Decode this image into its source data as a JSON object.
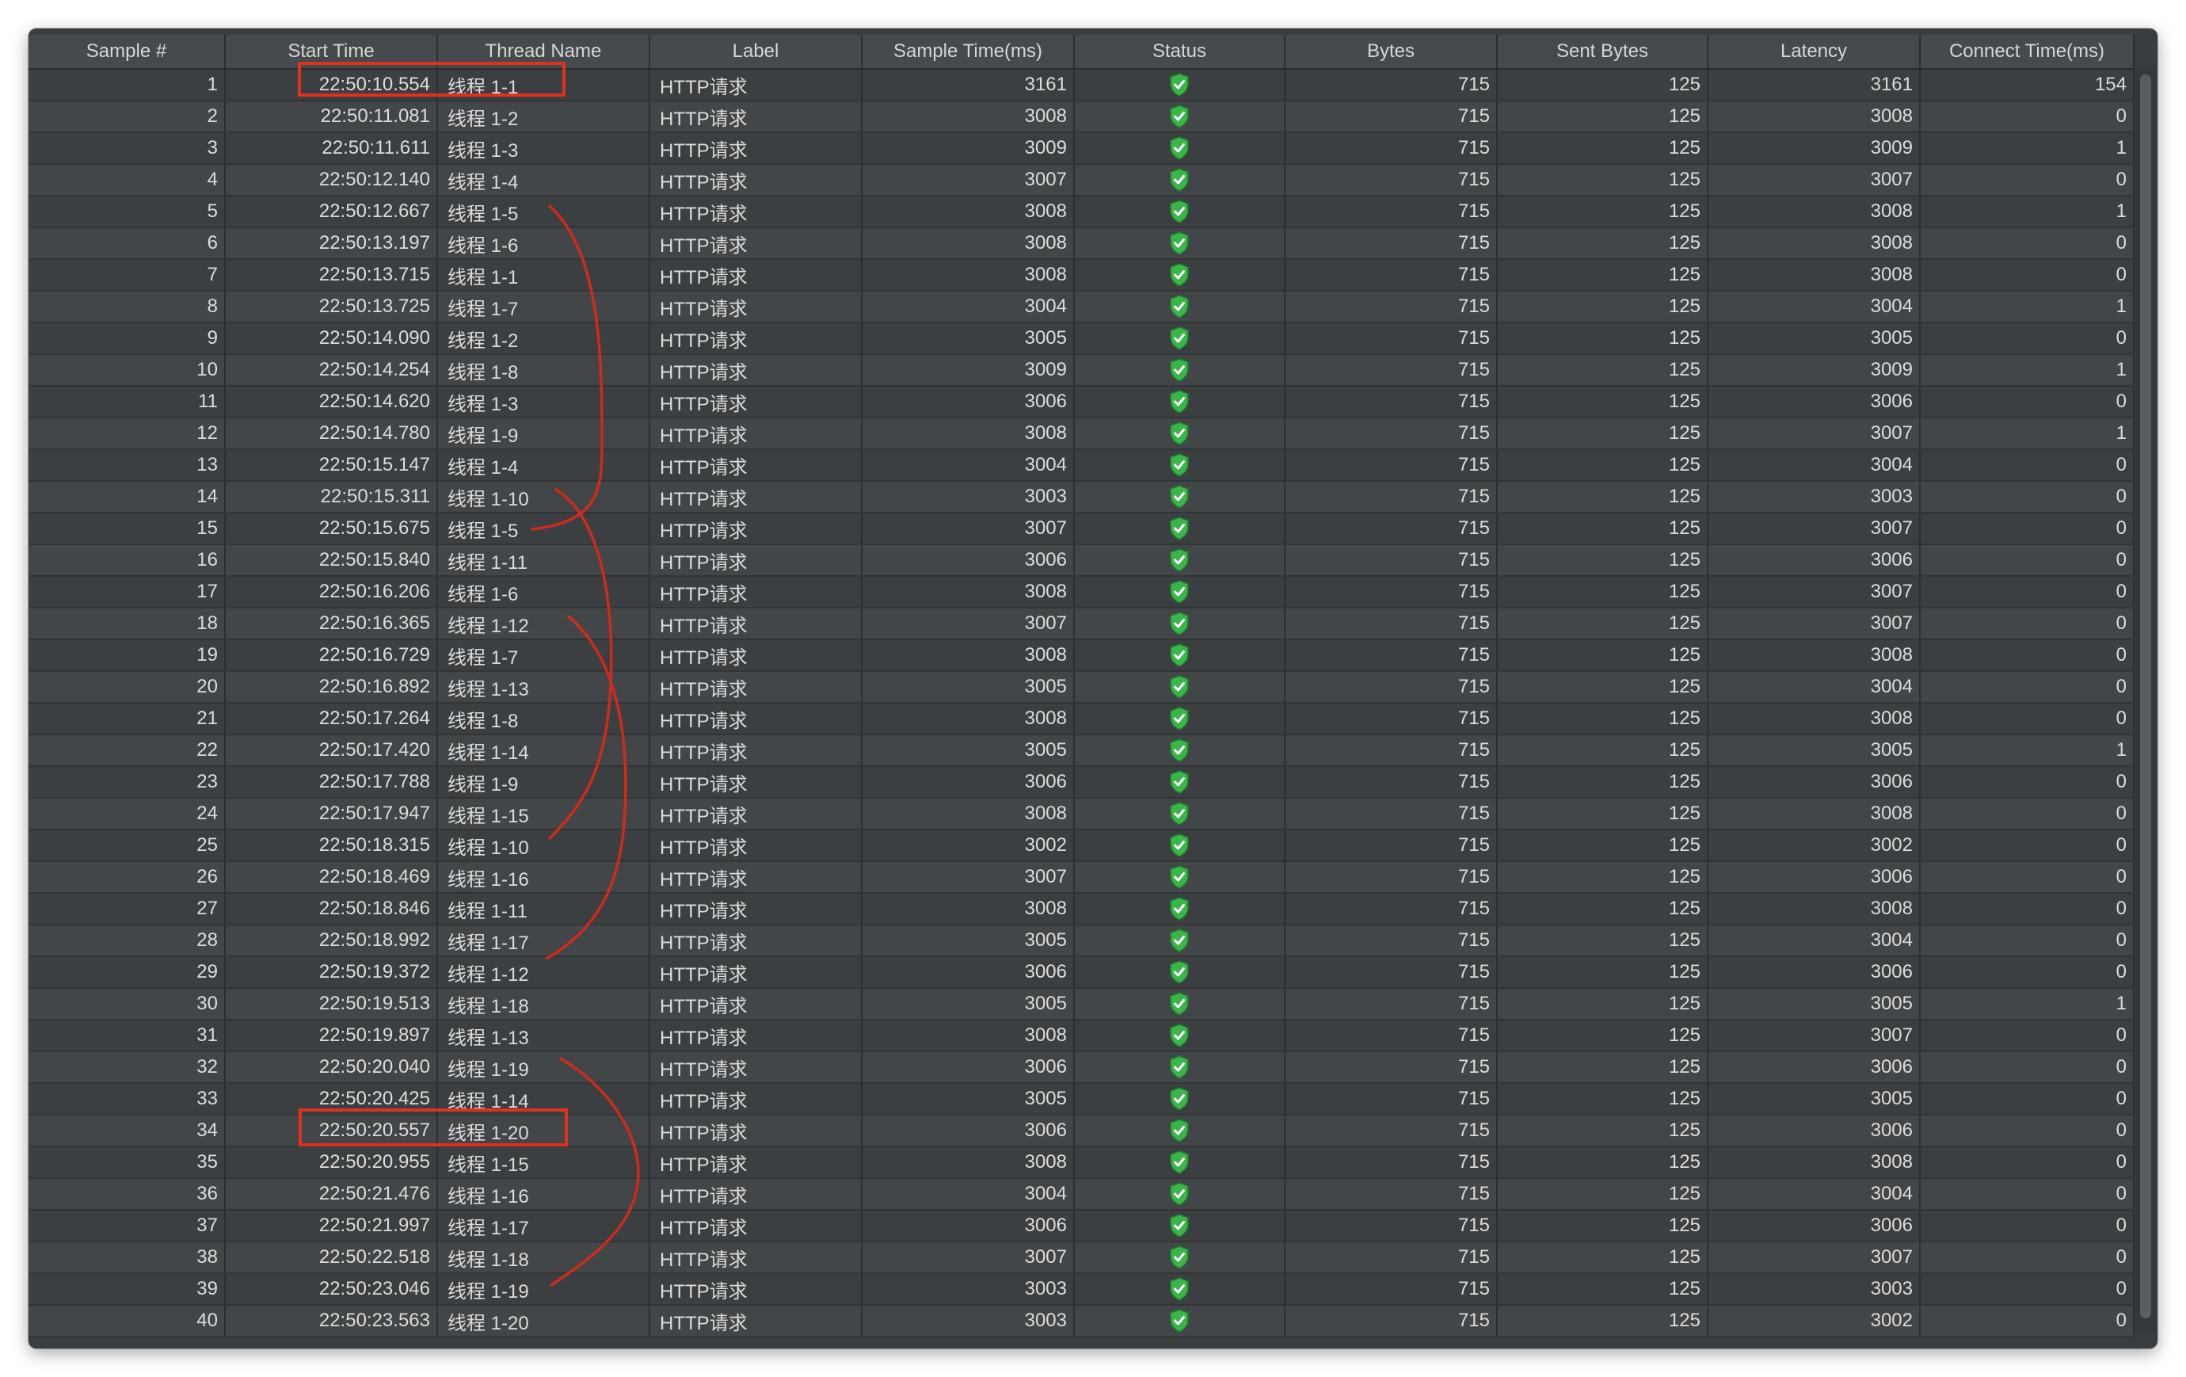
{
  "columns": [
    "Sample #",
    "Start Time",
    "Thread Name",
    "Label",
    "Sample Time(ms)",
    "Status",
    "Bytes",
    "Sent Bytes",
    "Latency",
    "Connect Time(ms)"
  ],
  "status_icon": "success-shield-icon",
  "colors": {
    "status_green": "#3bb54a",
    "annotation_red": "#e0301e"
  },
  "rows": [
    {
      "sample": "1",
      "start": "22:50:10.554",
      "thread": "线程 1-1",
      "label": "HTTP请求",
      "sample_time": "3161",
      "bytes": "715",
      "sent": "125",
      "latency": "3161",
      "connect": "154"
    },
    {
      "sample": "2",
      "start": "22:50:11.081",
      "thread": "线程 1-2",
      "label": "HTTP请求",
      "sample_time": "3008",
      "bytes": "715",
      "sent": "125",
      "latency": "3008",
      "connect": "0"
    },
    {
      "sample": "3",
      "start": "22:50:11.611",
      "thread": "线程 1-3",
      "label": "HTTP请求",
      "sample_time": "3009",
      "bytes": "715",
      "sent": "125",
      "latency": "3009",
      "connect": "1"
    },
    {
      "sample": "4",
      "start": "22:50:12.140",
      "thread": "线程 1-4",
      "label": "HTTP请求",
      "sample_time": "3007",
      "bytes": "715",
      "sent": "125",
      "latency": "3007",
      "connect": "0"
    },
    {
      "sample": "5",
      "start": "22:50:12.667",
      "thread": "线程 1-5",
      "label": "HTTP请求",
      "sample_time": "3008",
      "bytes": "715",
      "sent": "125",
      "latency": "3008",
      "connect": "1"
    },
    {
      "sample": "6",
      "start": "22:50:13.197",
      "thread": "线程 1-6",
      "label": "HTTP请求",
      "sample_time": "3008",
      "bytes": "715",
      "sent": "125",
      "latency": "3008",
      "connect": "0"
    },
    {
      "sample": "7",
      "start": "22:50:13.715",
      "thread": "线程 1-1",
      "label": "HTTP请求",
      "sample_time": "3008",
      "bytes": "715",
      "sent": "125",
      "latency": "3008",
      "connect": "0"
    },
    {
      "sample": "8",
      "start": "22:50:13.725",
      "thread": "线程 1-7",
      "label": "HTTP请求",
      "sample_time": "3004",
      "bytes": "715",
      "sent": "125",
      "latency": "3004",
      "connect": "1"
    },
    {
      "sample": "9",
      "start": "22:50:14.090",
      "thread": "线程 1-2",
      "label": "HTTP请求",
      "sample_time": "3005",
      "bytes": "715",
      "sent": "125",
      "latency": "3005",
      "connect": "0"
    },
    {
      "sample": "10",
      "start": "22:50:14.254",
      "thread": "线程 1-8",
      "label": "HTTP请求",
      "sample_time": "3009",
      "bytes": "715",
      "sent": "125",
      "latency": "3009",
      "connect": "1"
    },
    {
      "sample": "11",
      "start": "22:50:14.620",
      "thread": "线程 1-3",
      "label": "HTTP请求",
      "sample_time": "3006",
      "bytes": "715",
      "sent": "125",
      "latency": "3006",
      "connect": "0"
    },
    {
      "sample": "12",
      "start": "22:50:14.780",
      "thread": "线程 1-9",
      "label": "HTTP请求",
      "sample_time": "3008",
      "bytes": "715",
      "sent": "125",
      "latency": "3007",
      "connect": "1"
    },
    {
      "sample": "13",
      "start": "22:50:15.147",
      "thread": "线程 1-4",
      "label": "HTTP请求",
      "sample_time": "3004",
      "bytes": "715",
      "sent": "125",
      "latency": "3004",
      "connect": "0"
    },
    {
      "sample": "14",
      "start": "22:50:15.311",
      "thread": "线程 1-10",
      "label": "HTTP请求",
      "sample_time": "3003",
      "bytes": "715",
      "sent": "125",
      "latency": "3003",
      "connect": "0"
    },
    {
      "sample": "15",
      "start": "22:50:15.675",
      "thread": "线程 1-5",
      "label": "HTTP请求",
      "sample_time": "3007",
      "bytes": "715",
      "sent": "125",
      "latency": "3007",
      "connect": "0"
    },
    {
      "sample": "16",
      "start": "22:50:15.840",
      "thread": "线程 1-11",
      "label": "HTTP请求",
      "sample_time": "3006",
      "bytes": "715",
      "sent": "125",
      "latency": "3006",
      "connect": "0"
    },
    {
      "sample": "17",
      "start": "22:50:16.206",
      "thread": "线程 1-6",
      "label": "HTTP请求",
      "sample_time": "3008",
      "bytes": "715",
      "sent": "125",
      "latency": "3007",
      "connect": "0"
    },
    {
      "sample": "18",
      "start": "22:50:16.365",
      "thread": "线程 1-12",
      "label": "HTTP请求",
      "sample_time": "3007",
      "bytes": "715",
      "sent": "125",
      "latency": "3007",
      "connect": "0"
    },
    {
      "sample": "19",
      "start": "22:50:16.729",
      "thread": "线程 1-7",
      "label": "HTTP请求",
      "sample_time": "3008",
      "bytes": "715",
      "sent": "125",
      "latency": "3008",
      "connect": "0"
    },
    {
      "sample": "20",
      "start": "22:50:16.892",
      "thread": "线程 1-13",
      "label": "HTTP请求",
      "sample_time": "3005",
      "bytes": "715",
      "sent": "125",
      "latency": "3004",
      "connect": "0"
    },
    {
      "sample": "21",
      "start": "22:50:17.264",
      "thread": "线程 1-8",
      "label": "HTTP请求",
      "sample_time": "3008",
      "bytes": "715",
      "sent": "125",
      "latency": "3008",
      "connect": "0"
    },
    {
      "sample": "22",
      "start": "22:50:17.420",
      "thread": "线程 1-14",
      "label": "HTTP请求",
      "sample_time": "3005",
      "bytes": "715",
      "sent": "125",
      "latency": "3005",
      "connect": "1"
    },
    {
      "sample": "23",
      "start": "22:50:17.788",
      "thread": "线程 1-9",
      "label": "HTTP请求",
      "sample_time": "3006",
      "bytes": "715",
      "sent": "125",
      "latency": "3006",
      "connect": "0"
    },
    {
      "sample": "24",
      "start": "22:50:17.947",
      "thread": "线程 1-15",
      "label": "HTTP请求",
      "sample_time": "3008",
      "bytes": "715",
      "sent": "125",
      "latency": "3008",
      "connect": "0"
    },
    {
      "sample": "25",
      "start": "22:50:18.315",
      "thread": "线程 1-10",
      "label": "HTTP请求",
      "sample_time": "3002",
      "bytes": "715",
      "sent": "125",
      "latency": "3002",
      "connect": "0"
    },
    {
      "sample": "26",
      "start": "22:50:18.469",
      "thread": "线程 1-16",
      "label": "HTTP请求",
      "sample_time": "3007",
      "bytes": "715",
      "sent": "125",
      "latency": "3006",
      "connect": "0"
    },
    {
      "sample": "27",
      "start": "22:50:18.846",
      "thread": "线程 1-11",
      "label": "HTTP请求",
      "sample_time": "3008",
      "bytes": "715",
      "sent": "125",
      "latency": "3008",
      "connect": "0"
    },
    {
      "sample": "28",
      "start": "22:50:18.992",
      "thread": "线程 1-17",
      "label": "HTTP请求",
      "sample_time": "3005",
      "bytes": "715",
      "sent": "125",
      "latency": "3004",
      "connect": "0"
    },
    {
      "sample": "29",
      "start": "22:50:19.372",
      "thread": "线程 1-12",
      "label": "HTTP请求",
      "sample_time": "3006",
      "bytes": "715",
      "sent": "125",
      "latency": "3006",
      "connect": "0"
    },
    {
      "sample": "30",
      "start": "22:50:19.513",
      "thread": "线程 1-18",
      "label": "HTTP请求",
      "sample_time": "3005",
      "bytes": "715",
      "sent": "125",
      "latency": "3005",
      "connect": "1"
    },
    {
      "sample": "31",
      "start": "22:50:19.897",
      "thread": "线程 1-13",
      "label": "HTTP请求",
      "sample_time": "3008",
      "bytes": "715",
      "sent": "125",
      "latency": "3007",
      "connect": "0"
    },
    {
      "sample": "32",
      "start": "22:50:20.040",
      "thread": "线程 1-19",
      "label": "HTTP请求",
      "sample_time": "3006",
      "bytes": "715",
      "sent": "125",
      "latency": "3006",
      "connect": "0"
    },
    {
      "sample": "33",
      "start": "22:50:20.425",
      "thread": "线程 1-14",
      "label": "HTTP请求",
      "sample_time": "3005",
      "bytes": "715",
      "sent": "125",
      "latency": "3005",
      "connect": "0"
    },
    {
      "sample": "34",
      "start": "22:50:20.557",
      "thread": "线程 1-20",
      "label": "HTTP请求",
      "sample_time": "3006",
      "bytes": "715",
      "sent": "125",
      "latency": "3006",
      "connect": "0"
    },
    {
      "sample": "35",
      "start": "22:50:20.955",
      "thread": "线程 1-15",
      "label": "HTTP请求",
      "sample_time": "3008",
      "bytes": "715",
      "sent": "125",
      "latency": "3008",
      "connect": "0"
    },
    {
      "sample": "36",
      "start": "22:50:21.476",
      "thread": "线程 1-16",
      "label": "HTTP请求",
      "sample_time": "3004",
      "bytes": "715",
      "sent": "125",
      "latency": "3004",
      "connect": "0"
    },
    {
      "sample": "37",
      "start": "22:50:21.997",
      "thread": "线程 1-17",
      "label": "HTTP请求",
      "sample_time": "3006",
      "bytes": "715",
      "sent": "125",
      "latency": "3006",
      "connect": "0"
    },
    {
      "sample": "38",
      "start": "22:50:22.518",
      "thread": "线程 1-18",
      "label": "HTTP请求",
      "sample_time": "3007",
      "bytes": "715",
      "sent": "125",
      "latency": "3007",
      "connect": "0"
    },
    {
      "sample": "39",
      "start": "22:50:23.046",
      "thread": "线程 1-19",
      "label": "HTTP请求",
      "sample_time": "3003",
      "bytes": "715",
      "sent": "125",
      "latency": "3003",
      "connect": "0"
    },
    {
      "sample": "40",
      "start": "22:50:23.563",
      "thread": "线程 1-20",
      "label": "HTTP请求",
      "sample_time": "3003",
      "bytes": "715",
      "sent": "125",
      "latency": "3002",
      "connect": "0"
    }
  ]
}
